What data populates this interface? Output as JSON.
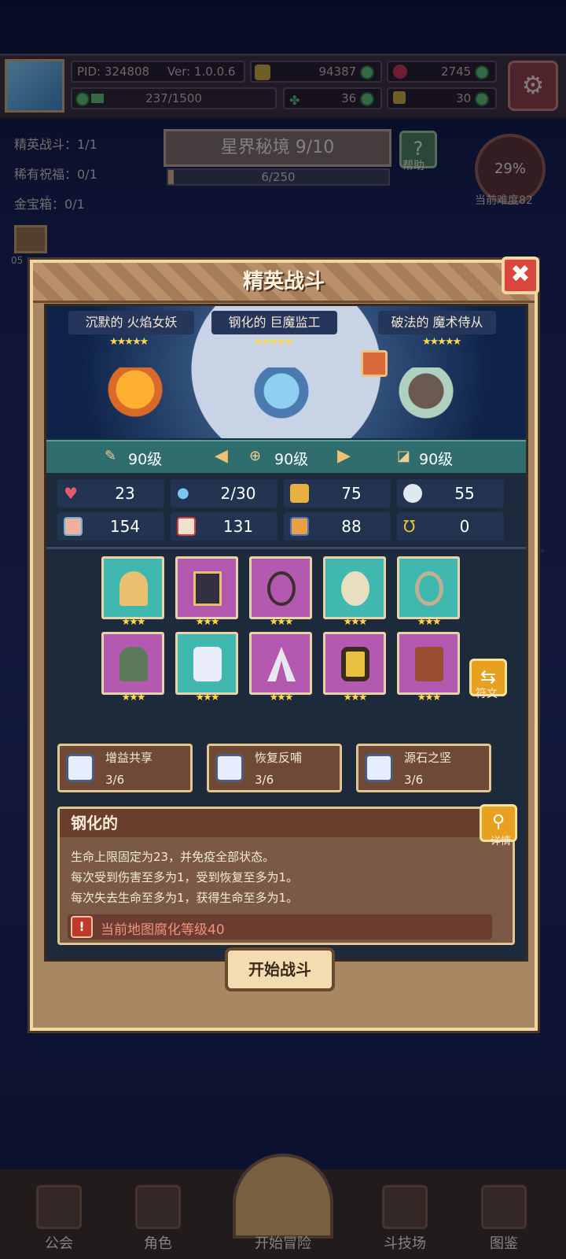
{
  "topbar": {
    "pid": "PID: 324808",
    "version": "Ver: 1.0.0.6",
    "gold": "94387",
    "gems": "2745",
    "energy": "237/1500",
    "clover": "36",
    "keys": "30"
  },
  "sidebar": {
    "elite_battle": "精英战斗：1/1",
    "rare_blessing": "稀有祝福：0/1",
    "gold_chest": "金宝箱：0/1",
    "chest_count": "05"
  },
  "stage": {
    "title": "星界秘境 9/10",
    "progress": "6/250",
    "progress_fraction": 0.024,
    "help_label": "帮助",
    "difficulty_pct": "29%",
    "difficulty_label": "当前难度82"
  },
  "dialog": {
    "title": "精英战斗",
    "close_symbol": "✖",
    "enemies": [
      {
        "name": "沉默的 火焰女妖",
        "stars": "★★★★★",
        "level": "90级"
      },
      {
        "name": "钢化的 巨魔监工",
        "stars": "★★★★★",
        "level": "90级"
      },
      {
        "name": "破法的 魔术侍从",
        "stars": "★★★★★",
        "level": "90级"
      }
    ],
    "stats": [
      "23",
      "2/30",
      "75",
      "55",
      "154",
      "131",
      "88",
      "0"
    ],
    "equipment_stars": "★★★",
    "rune_label": "符文",
    "blessings": [
      {
        "name": "增益共享",
        "count": "3/6"
      },
      {
        "name": "恢复反哺",
        "count": "3/6"
      },
      {
        "name": "源石之坚",
        "count": "3/6"
      }
    ],
    "desc": {
      "title": "钢化的",
      "detail_label": "详情",
      "lines": [
        "生命上限固定为23，并免疫全部状态。",
        "每次受到伤害至多为1，受到恢复至多为1。",
        "每次失去生命至多为1，获得生命至多为1。"
      ],
      "warning": "当前地图腐化等级40"
    },
    "start_button": "开始战斗"
  },
  "nav": {
    "guild": "公会",
    "character": "角色",
    "adventure": "开始冒险",
    "arena": "斗技场",
    "codex": "图鉴"
  },
  "colors": {
    "accent_gold": "#f0d6a0",
    "close_red": "#d9463d",
    "star_yellow": "#ffd84a",
    "warning_red": "#e05a4a"
  }
}
